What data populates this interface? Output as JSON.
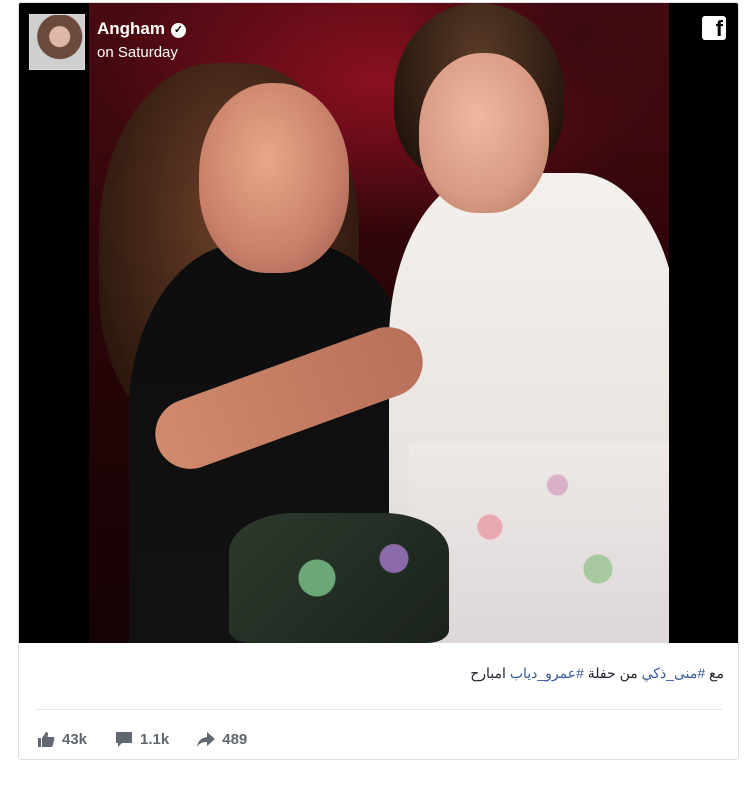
{
  "post": {
    "author": "Angham",
    "date": "on Saturday",
    "caption_parts": [
      "مع ",
      "#منى_ذكي",
      " من حفلة ",
      "#عمرو_دياب",
      " امبارح"
    ],
    "photo_alt": "Angham and Mona Zaki",
    "icons": {
      "verified": "verified-badge-icon",
      "brand": "facebook-icon",
      "like": "like-icon",
      "comment": "comment-icon",
      "share": "share-icon"
    }
  },
  "stats": {
    "likes": "43k",
    "comments": "1.1k",
    "shares": "489"
  },
  "colors": {
    "hashtag": "#365899",
    "media_bg": "#000000",
    "action_text": "#616770"
  }
}
